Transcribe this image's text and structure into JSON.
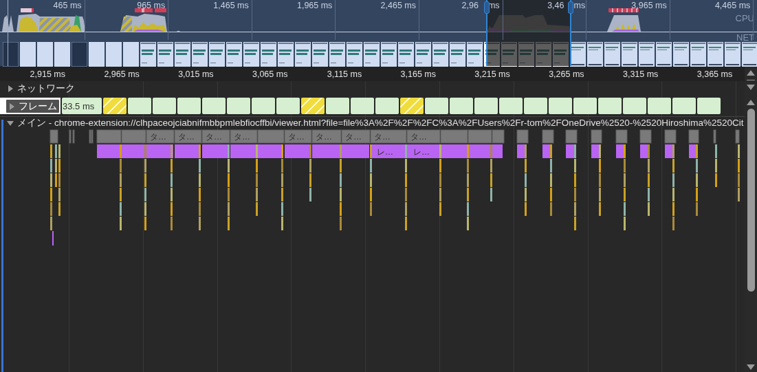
{
  "overview": {
    "time_labels": [
      {
        "parts": [
          "465 ms"
        ]
      },
      {
        "parts": [
          "965 ms"
        ]
      },
      {
        "parts": [
          "1,465 ms"
        ]
      },
      {
        "parts": [
          "1,965 ms"
        ]
      },
      {
        "parts": [
          "2,465 ms"
        ]
      },
      {
        "parts": [
          "2,96",
          "ms"
        ]
      },
      {
        "parts": [
          "3,46",
          "ms"
        ]
      },
      {
        "parts": [
          "3,965 ms"
        ]
      },
      {
        "parts": [
          "4,465 ms"
        ]
      }
    ],
    "track_labels": [
      "CPU",
      "NET"
    ]
  },
  "ruler": {
    "labels": [
      "2,915 ms",
      "2,965 ms",
      "3,015 ms",
      "3,065 ms",
      "3,115 ms",
      "3,165 ms",
      "3,215 ms",
      "3,265 ms",
      "3,315 ms",
      "3,365 ms"
    ]
  },
  "tracks": [
    {
      "kind": "network",
      "label": "ネットワーク",
      "expanded": false
    },
    {
      "kind": "frames",
      "label": "フレーム",
      "expanded": false,
      "frames": [
        {
          "label": "33.5 ms",
          "partial": false
        },
        {
          "partial": true
        },
        {
          "partial": false
        },
        {
          "partial": false
        },
        {
          "partial": false
        },
        {
          "partial": false
        },
        {
          "partial": false
        },
        {
          "partial": false
        },
        {
          "partial": false
        },
        {
          "partial": true
        },
        {
          "partial": false
        },
        {
          "partial": false
        },
        {
          "partial": false
        },
        {
          "partial": true
        },
        {
          "partial": false
        },
        {
          "partial": false
        },
        {
          "partial": false
        },
        {
          "partial": false
        },
        {
          "partial": false
        },
        {
          "partial": false
        },
        {
          "partial": false
        },
        {
          "partial": false
        },
        {
          "partial": false
        },
        {
          "partial": false
        },
        {
          "partial": false
        },
        {
          "partial": false
        }
      ]
    },
    {
      "kind": "main",
      "label": "メイン - chrome-extension://clhpaceojciabnifmbbpmlebfiocffbi/viewer.html?file=file%3A%2F%2F%2FC%3A%2FUsers%2Fr-tom%2FOneDrive%2520-%2520Hiroshima%2520Cit",
      "expanded": true,
      "task_labels": [
        "タ…",
        "タ…",
        "タ…",
        "タ…",
        "タ…",
        "タ…",
        "タ…",
        "タ…",
        "タ…"
      ],
      "function_labels": [
        "レ…",
        "レ…"
      ]
    }
  ]
}
